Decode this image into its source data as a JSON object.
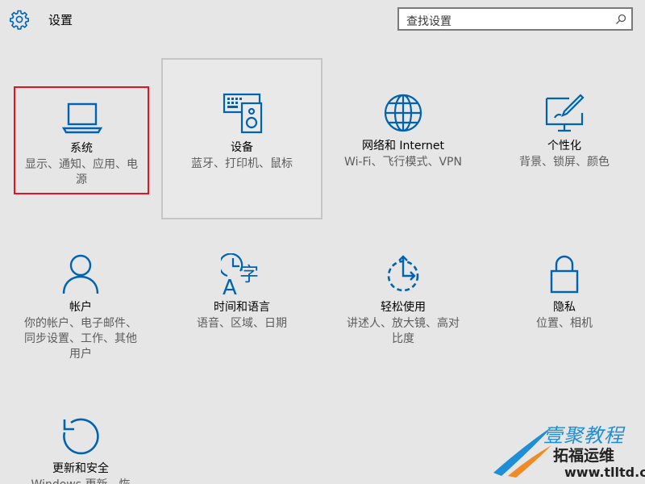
{
  "header": {
    "title": "设置",
    "search_placeholder": "查找设置"
  },
  "colors": {
    "accent": "#0063b1",
    "selected_border": "#e81123",
    "background": "#e6e6e6"
  },
  "tiles": [
    {
      "name": "系统",
      "desc": "显示、通知、应用、电\n源",
      "icon": "laptop-icon",
      "state": "selected"
    },
    {
      "name": "设备",
      "desc": "蓝牙、打印机、鼠标",
      "icon": "devices-icon",
      "state": "hovered"
    },
    {
      "name": "网络和 Internet",
      "desc": "Wi-Fi、飞行模式、VPN",
      "icon": "globe-icon",
      "state": "normal"
    },
    {
      "name": "个性化",
      "desc": "背景、锁屏、颜色",
      "icon": "personalization-icon",
      "state": "normal"
    },
    {
      "name": "帐户",
      "desc": "你的帐户、电子邮件、\n同步设置、工作、其他\n用户",
      "icon": "person-icon",
      "state": "normal"
    },
    {
      "name": "时间和语言",
      "desc": "语音、区域、日期",
      "icon": "time-language-icon",
      "state": "normal"
    },
    {
      "name": "轻松使用",
      "desc": "讲述人、放大镜、高对\n比度",
      "icon": "ease-of-access-icon",
      "state": "normal"
    },
    {
      "name": "隐私",
      "desc": "位置、相机",
      "icon": "lock-icon",
      "state": "normal"
    },
    {
      "name": "更新和安全",
      "desc": "Windows 更新、恢",
      "icon": "update-icon",
      "state": "normal"
    }
  ],
  "watermark": {
    "line1": "壹聚教程",
    "line2": "拓福运维",
    "line3": "www.tlltd.cn"
  }
}
